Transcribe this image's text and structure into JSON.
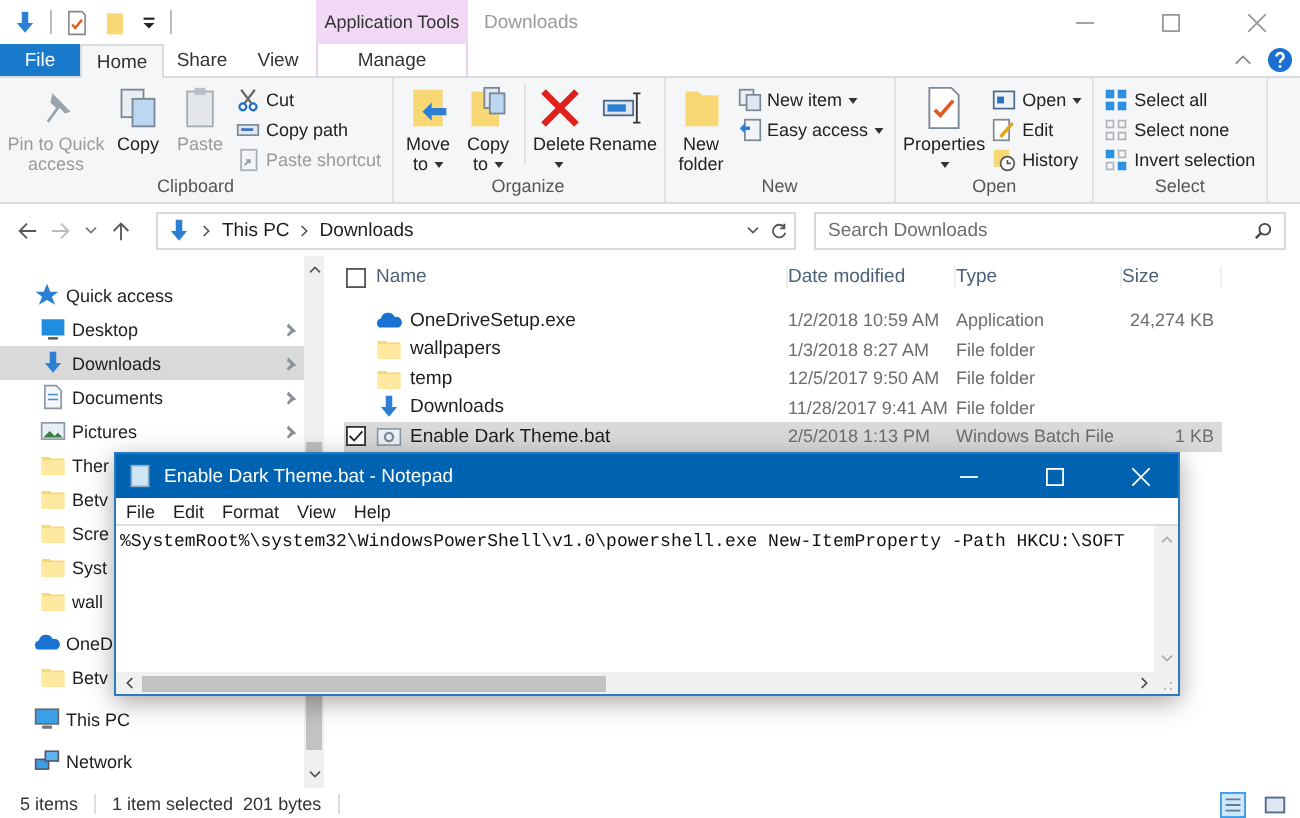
{
  "window": {
    "title": "Downloads",
    "context_group": "Application Tools"
  },
  "tabs": [
    {
      "label": "File",
      "kind": "file",
      "selected": false
    },
    {
      "label": "Home",
      "kind": "tab",
      "selected": true
    },
    {
      "label": "Share",
      "kind": "tab",
      "selected": false
    },
    {
      "label": "View",
      "kind": "tab",
      "selected": false
    },
    {
      "label": "Manage",
      "kind": "contextual",
      "selected": false
    }
  ],
  "ribbon": {
    "groups": [
      {
        "label": "Clipboard",
        "items": [
          {
            "label": "Pin to Quick access",
            "disabled": true,
            "dropdown": false
          },
          {
            "label": "Copy",
            "disabled": false,
            "dropdown": false
          },
          {
            "label": "Paste",
            "disabled": true,
            "dropdown": false
          },
          {
            "label": "Cut",
            "disabled": false,
            "dropdown": false
          },
          {
            "label": "Copy path",
            "disabled": false,
            "dropdown": false
          },
          {
            "label": "Paste shortcut",
            "disabled": true,
            "dropdown": false
          }
        ]
      },
      {
        "label": "Organize",
        "items": [
          {
            "label": "Move to",
            "disabled": false,
            "dropdown": true
          },
          {
            "label": "Copy to",
            "disabled": false,
            "dropdown": true
          },
          {
            "label": "Delete",
            "disabled": false,
            "dropdown": true
          },
          {
            "label": "Rename",
            "disabled": false,
            "dropdown": false
          }
        ]
      },
      {
        "label": "New",
        "items": [
          {
            "label": "New folder",
            "disabled": false,
            "dropdown": false
          },
          {
            "label": "New item",
            "disabled": false,
            "dropdown": true
          },
          {
            "label": "Easy access",
            "disabled": false,
            "dropdown": true
          }
        ]
      },
      {
        "label": "Open",
        "items": [
          {
            "label": "Properties",
            "disabled": false,
            "dropdown": true
          },
          {
            "label": "Open",
            "disabled": false,
            "dropdown": true
          },
          {
            "label": "Edit",
            "disabled": false,
            "dropdown": false
          },
          {
            "label": "History",
            "disabled": false,
            "dropdown": false
          }
        ]
      },
      {
        "label": "Select",
        "items": [
          {
            "label": "Select all",
            "disabled": false,
            "dropdown": false
          },
          {
            "label": "Select none",
            "disabled": false,
            "dropdown": false
          },
          {
            "label": "Invert selection",
            "disabled": false,
            "dropdown": false
          }
        ]
      }
    ]
  },
  "address": {
    "path": [
      "This PC",
      "Downloads"
    ]
  },
  "search": {
    "placeholder": "Search Downloads"
  },
  "sidebar": {
    "items": [
      {
        "label": "Quick access",
        "kind": "star",
        "selected": false,
        "children": [
          {
            "label": "Desktop",
            "kind": "desktop",
            "selected": false,
            "pinned": true
          },
          {
            "label": "Downloads",
            "kind": "download",
            "selected": true,
            "pinned": true
          },
          {
            "label": "Documents",
            "kind": "documents",
            "selected": false,
            "pinned": true
          },
          {
            "label": "Pictures",
            "kind": "pictures",
            "selected": false,
            "pinned": true
          },
          {
            "label": "Ther",
            "kind": "folder",
            "selected": false
          },
          {
            "label": "Betv",
            "kind": "folder",
            "selected": false
          },
          {
            "label": "Scre",
            "kind": "folder",
            "selected": false
          },
          {
            "label": "Syst",
            "kind": "folder",
            "selected": false
          },
          {
            "label": "wall",
            "kind": "folder",
            "selected": false
          }
        ]
      },
      {
        "label": "OneD",
        "kind": "onedrive",
        "selected": false,
        "children": [
          {
            "label": "Betv",
            "kind": "folder",
            "selected": false
          }
        ]
      },
      {
        "label": "This PC",
        "kind": "pc",
        "selected": false
      },
      {
        "label": "Network",
        "kind": "network",
        "selected": false
      }
    ]
  },
  "table": {
    "all_checked": false,
    "columns": [
      "Name",
      "Date modified",
      "Type",
      "Size"
    ],
    "rows": [
      {
        "name": "OneDriveSetup.exe",
        "date": "1/2/2018 10:59 AM",
        "type": "Application",
        "size": "24,274 KB",
        "kind": "onedrive",
        "selected": false
      },
      {
        "name": "wallpapers",
        "date": "1/3/2018 8:27 AM",
        "type": "File folder",
        "kind": "folder",
        "selected": false
      },
      {
        "name": "temp",
        "date": "12/5/2017 9:50 AM",
        "type": "File folder",
        "kind": "folder",
        "selected": false
      },
      {
        "name": "Downloads",
        "date": "11/28/2017 9:41 AM",
        "type": "File folder",
        "kind": "download",
        "selected": false
      },
      {
        "name": "Enable Dark Theme.bat",
        "date": "2/5/2018 1:13 PM",
        "type": "Windows Batch File",
        "size": "1 KB",
        "kind": "batch",
        "selected": true
      }
    ]
  },
  "status_bar": {
    "item_count": "5 items",
    "selection": "1 item selected",
    "size": "201 bytes",
    "views": [
      {
        "selected": true
      },
      {
        "selected": false
      }
    ]
  },
  "notepad": {
    "title": "Enable Dark Theme.bat - Notepad",
    "menu": [
      "File",
      "Edit",
      "Format",
      "View",
      "Help"
    ],
    "text": "%SystemRoot%\\system32\\WindowsPowerShell\\v1.0\\powershell.exe New-ItemProperty -Path HKCU:\\SOFT"
  }
}
